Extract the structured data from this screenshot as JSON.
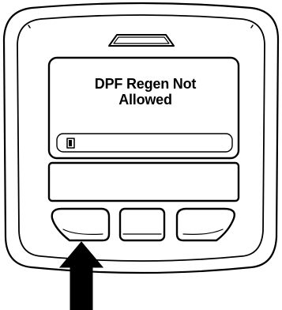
{
  "display": {
    "message_line1": "DPF Regen Not",
    "message_line2": "Allowed",
    "status_icon": "fuel-gauge-icon"
  },
  "buttons": [
    {
      "name": "left-softkey-button",
      "pressed_indicator": true
    },
    {
      "name": "center-softkey-button"
    },
    {
      "name": "right-softkey-button"
    }
  ],
  "indicator": "arrow-up-icon",
  "colors": {
    "line": "#000000",
    "face": "#ffffff"
  }
}
